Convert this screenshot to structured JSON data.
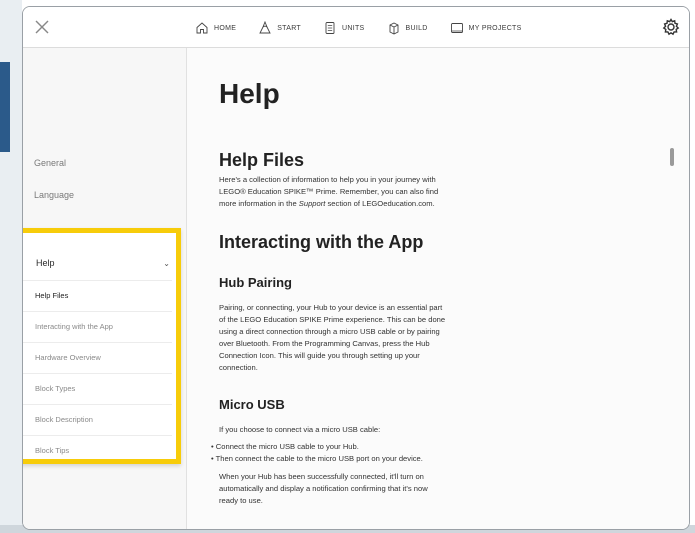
{
  "nav": {
    "home": "HOME",
    "start": "START",
    "units": "UNITS",
    "build": "BUILD",
    "my_projects": "MY PROJECTS"
  },
  "sidebar": {
    "general": "General",
    "language": "Language",
    "help": {
      "title": "Help",
      "items": [
        "Help Files",
        "Interacting with the App",
        "Hardware Overview",
        "Block Types",
        "Block Description",
        "Block Tips"
      ]
    }
  },
  "content": {
    "title": "Help",
    "help_files": {
      "heading": "Help Files",
      "line1": "Here's a collection of information to help you in your journey with",
      "line2": "LEGO® Education SPIKE™ Prime. Remember, you can also find",
      "line3_before": "more information in the ",
      "line3_em": "Support",
      "line3_after": " section of LEGOeducation.com."
    },
    "interacting": {
      "heading": "Interacting with the App",
      "hub_pairing": {
        "heading": "Hub Pairing",
        "lines": [
          "Pairing, or connecting, your Hub to your device is an essential part",
          "of the LEGO Education SPIKE Prime experience. This can be done",
          "using a direct connection through a micro USB cable or by pairing",
          "over Bluetooth. From the Programming Canvas, press the Hub",
          "Connection Icon. This will guide you through setting up your",
          "connection."
        ]
      },
      "micro_usb": {
        "heading": "Micro USB",
        "intro": "If you choose to connect via a micro USB cable:",
        "bullets": [
          "Connect the micro USB cable to your Hub.",
          "Then connect the cable to the micro USB port on your device."
        ],
        "outro_lines": [
          "When your Hub has been successfully connected, it'll turn on",
          "automatically and display a notification confirming that it's now",
          "ready to use."
        ]
      }
    }
  },
  "colors": {
    "highlight": "#f7cc0a",
    "text": "#222222"
  }
}
